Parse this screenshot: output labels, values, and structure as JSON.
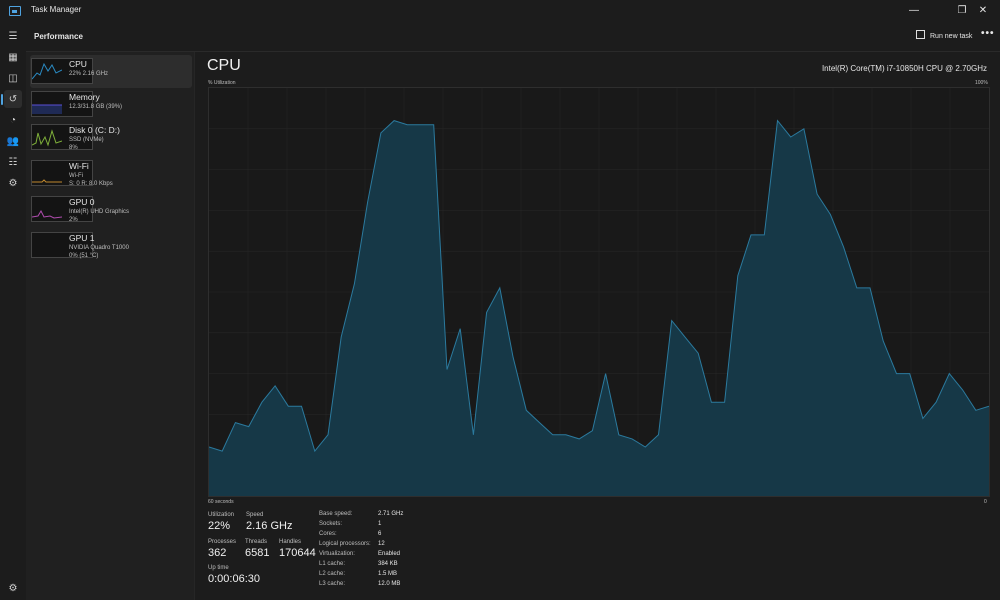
{
  "window": {
    "title": "Task Manager",
    "minimize": "—",
    "maximize": "❐",
    "close": "✕"
  },
  "rail": {
    "icons": [
      "hamburger-icon",
      "processes-icon",
      "performance-icon",
      "app-history-icon",
      "startup-apps-icon",
      "users-icon",
      "details-icon",
      "services-icon",
      "settings-icon"
    ]
  },
  "header": {
    "page": "Performance",
    "run_new_task": "Run new task",
    "more": "•••"
  },
  "sidebar": {
    "items": [
      {
        "name": "CPU",
        "sub": [
          "22%  2.16 GHz"
        ],
        "color": "#2a8bc4",
        "fill": "#1a3a4c"
      },
      {
        "name": "Memory",
        "sub": [
          "12.3/31.8 GB (39%)"
        ],
        "color": "#5a4fd8",
        "fill": "#1f2a55"
      },
      {
        "name": "Disk 0 (C: D:)",
        "sub": [
          "SSD (NVMe)",
          "8%"
        ],
        "color": "#7fb03a",
        "fill": "#2b3a1e"
      },
      {
        "name": "Wi-Fi",
        "sub": [
          "Wi-Fi",
          "S: 0  R: 8.0 Kbps"
        ],
        "color": "#c1892e",
        "fill": "#2a2a2a"
      },
      {
        "name": "GPU 0",
        "sub": [
          "Intel(R) UHD Graphics",
          "2%"
        ],
        "color": "#b14db0",
        "fill": "#2b1a2b"
      },
      {
        "name": "GPU 1",
        "sub": [
          "NVIDIA Quadro T1000",
          "0%  (51 °C)"
        ],
        "color": "#b14db0",
        "fill": "#2a2a2a"
      }
    ]
  },
  "main": {
    "title": "CPU",
    "model": "Intel(R) Core(TM) i7-10850H CPU @ 2.70GHz",
    "util_label": "% Utilization",
    "max_label": "100%",
    "time_left": "60 seconds",
    "time_right": "0"
  },
  "chart_data": {
    "type": "area",
    "title": "",
    "ylabel": "% Utilization",
    "ylim": [
      0,
      100
    ],
    "xlim": [
      60,
      0
    ],
    "series": [
      {
        "values": [
          12,
          11,
          18,
          17,
          23,
          27,
          22,
          22,
          11,
          15,
          39,
          52,
          72,
          89,
          92,
          91,
          91,
          91,
          31,
          41,
          15,
          45,
          51,
          34,
          21,
          18,
          15,
          15,
          14,
          16,
          30,
          15,
          14,
          12,
          15,
          43,
          39,
          35,
          23,
          23,
          54,
          64,
          64,
          92,
          88,
          90,
          74,
          69,
          61,
          51,
          51,
          38,
          30,
          30,
          19,
          23,
          30,
          26,
          21,
          22
        ],
        "color": "#2b7a9e"
      }
    ]
  },
  "stats": {
    "utilization": {
      "label": "Utilization",
      "value": "22%"
    },
    "speed": {
      "label": "Speed",
      "value": "2.16 GHz"
    },
    "processes": {
      "label": "Processes",
      "value": "362"
    },
    "threads": {
      "label": "Threads",
      "value": "6581"
    },
    "handles": {
      "label": "Handles",
      "value": "170644"
    },
    "uptime": {
      "label": "Up time",
      "value": "0:00:06:30"
    }
  },
  "info": [
    {
      "key": "Base speed:",
      "val": "2.71 GHz"
    },
    {
      "key": "Sockets:",
      "val": "1"
    },
    {
      "key": "Cores:",
      "val": "6"
    },
    {
      "key": "Logical processors:",
      "val": "12"
    },
    {
      "key": "Virtualization:",
      "val": "Enabled"
    },
    {
      "key": "L1 cache:",
      "val": "384 KB"
    },
    {
      "key": "L2 cache:",
      "val": "1.5 MB"
    },
    {
      "key": "L3 cache:",
      "val": "12.0 MB"
    }
  ]
}
